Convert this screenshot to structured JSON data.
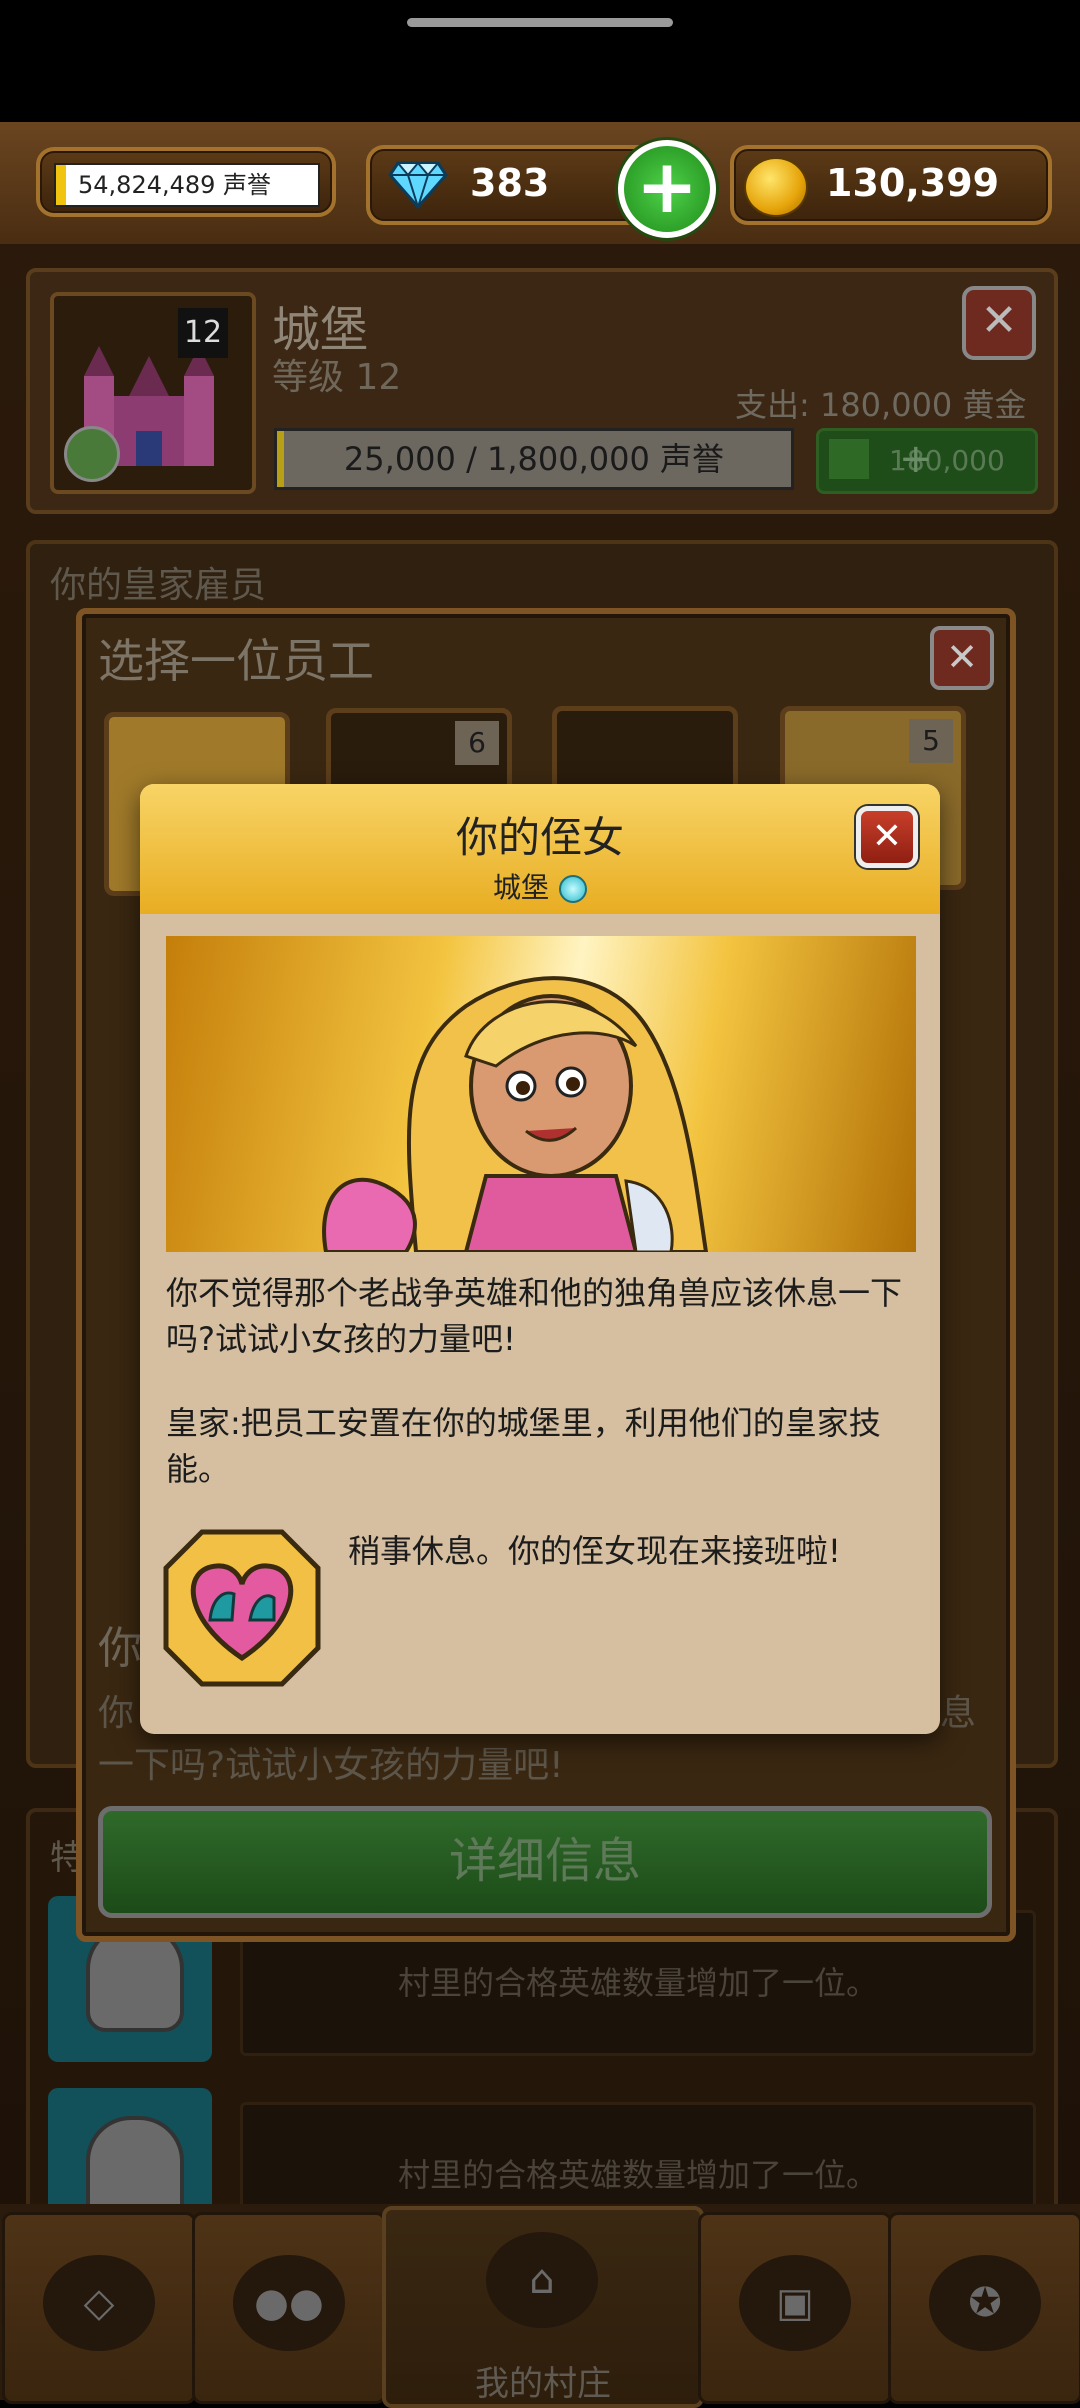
{
  "topbar": {
    "reputation": "54,824,489 声誉",
    "gems": "383",
    "gold": "130,399",
    "colors": {
      "gold_bar": "#f1c40f",
      "plus_button": "#2fa52a"
    }
  },
  "castle_panel": {
    "level_badge": "12",
    "title": "城堡",
    "level_text": "等级 12",
    "cost": "支出: 180,000 黄金",
    "progress": "25,000 / 1,800,000 声誉",
    "progress_fraction": 0.0139,
    "upgrade_label": "180,000"
  },
  "royal_staff": {
    "title": "你的皇家雇员"
  },
  "choose_dialog": {
    "title": "选择一位员工",
    "card_badges": [
      "",
      "6",
      "",
      "5"
    ],
    "desc_fragment_1": "你",
    "desc_fragment_2": "你",
    "desc_fragment_3": "息",
    "desc_line": "一下吗?试试小女孩的力量吧!",
    "details_button": "详细信息"
  },
  "side_label": "特",
  "hero_rows": [
    {
      "text": "村里的合格英雄数量增加了一位。"
    },
    {
      "text": "村里的合格英雄数量增加了一位。"
    }
  ],
  "modal": {
    "title": "你的侄女",
    "subtitle": "城堡",
    "paragraph1": "你不觉得那个老战争英雄和他的独角兽应该休息一下吗?试试小女孩的力量吧!",
    "paragraph2": "皇家:把员工安置在你的城堡里，利用他们的皇家技能。",
    "skill_text": "稍事休息。你的侄女现在来接班啦!",
    "icons": [
      "close-icon",
      "heart-skill-icon",
      "portrait-image"
    ]
  },
  "bottom_nav": {
    "village_label": "我的村庄",
    "items": [
      "diamond-icon",
      "people-icon",
      "home-icon",
      "chest-icon",
      "medal-icon"
    ]
  }
}
